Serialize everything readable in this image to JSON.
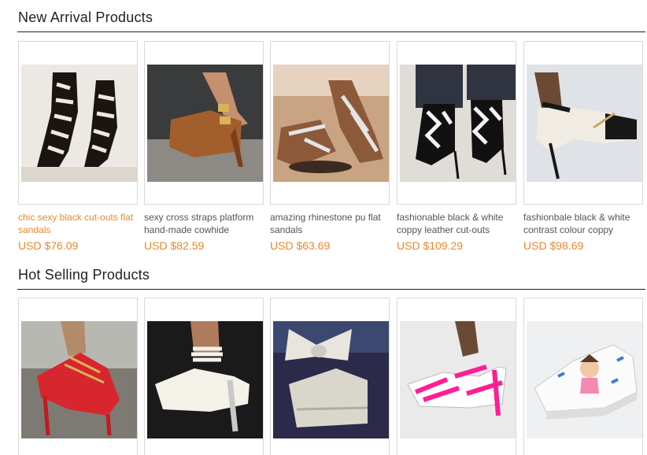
{
  "sections": {
    "new_arrival": {
      "title": "New Arrival Products",
      "products": [
        {
          "name": "chic sexy black cut-outs flat sandals",
          "price": "USD $76.09",
          "image": "black cut-out knee sandal photo"
        },
        {
          "name": "sexy cross straps platform hand-made cowhide",
          "price": "USD $82.59",
          "image": "tan platform heel photo"
        },
        {
          "name": "amazing rhinestone pu flat sandals",
          "price": "USD $63.69",
          "image": "rhinestone flat sandal photo"
        },
        {
          "name": "fashionable black & white coppy leather cut-outs",
          "price": "USD $109.29",
          "image": "black white patterned heel photo"
        },
        {
          "name": "fashionbale black & white contrast colour coppy",
          "price": "USD $98.69",
          "image": "black white peep toe heel photo"
        }
      ]
    },
    "hot_selling": {
      "title": "Hot Selling Products",
      "products": [
        {
          "image": "red platform heel photo"
        },
        {
          "image": "white pearl ankle heel photo"
        },
        {
          "image": "white bow wedge photo"
        },
        {
          "image": "pink white strappy heel photo"
        },
        {
          "image": "painted canvas sneaker photo"
        }
      ]
    }
  },
  "colors": {
    "accent": "#e8892c",
    "text": "#555555",
    "title": "#222222",
    "border": "#d8d8d8"
  }
}
